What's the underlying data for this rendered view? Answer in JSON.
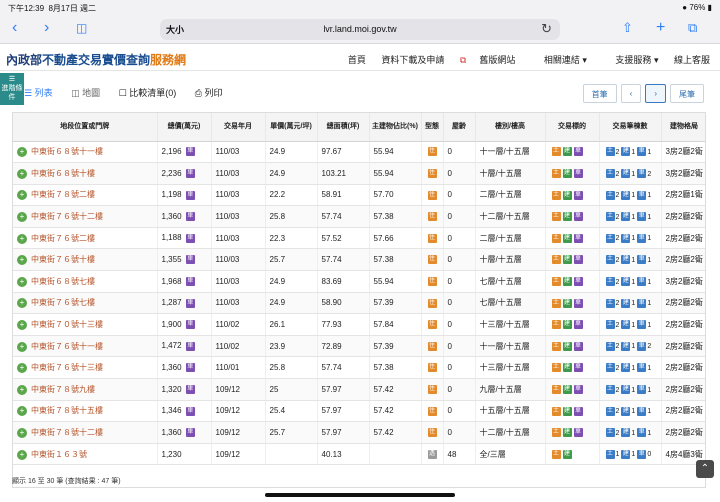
{
  "status": {
    "time": "下午12:39",
    "date": "8月17日 週二",
    "battery": "76%"
  },
  "browser": {
    "aa": "大小",
    "url": "lvr.land.moi.gov.tw"
  },
  "header": {
    "ministry": "內政部",
    "title_main": "不動產交易實價查詢",
    "title_sub": "服務網",
    "nav": [
      "首頁",
      "資料下載及申請",
      "舊版網站",
      "相關連結",
      "支援服務",
      "線上客服"
    ]
  },
  "sidetag": "進階條件",
  "viewbar": {
    "list": "列表",
    "map": "地圖",
    "compare": "比較清單(0)",
    "print": "列印"
  },
  "pager": {
    "first": "首筆",
    "prev": "‹",
    "next": "›",
    "last": "尾筆"
  },
  "columns": [
    "地段位置或門牌",
    "總價(萬元)",
    "交易年月",
    "單價(萬元/坪)",
    "總面積(坪)",
    "主建物佔比(%)",
    "型態",
    "屋齡",
    "樓別/樓高",
    "交易標的",
    "交易筆棟數",
    "建物格局"
  ],
  "rows": [
    {
      "addr": "中東街６８號十一樓",
      "price": "2,196",
      "date": "110/03",
      "unit": "24.9",
      "area": "97.67",
      "ratio": "55.94",
      "type": "住",
      "age": "0",
      "floor": "十一層/十五層",
      "c1": "2",
      "c2": "1",
      "c3": "1",
      "layout": "3房2廳2衛",
      "ptag": true
    },
    {
      "addr": "中東街６８號十樓",
      "price": "2,236",
      "date": "110/03",
      "unit": "24.9",
      "area": "103.21",
      "ratio": "55.94",
      "type": "住",
      "age": "0",
      "floor": "十層/十五層",
      "c1": "2",
      "c2": "1",
      "c3": "2",
      "layout": "3房2廳2衛",
      "ptag": true
    },
    {
      "addr": "中東街７８號二樓",
      "price": "1,198",
      "date": "110/03",
      "unit": "22.2",
      "area": "58.91",
      "ratio": "57.70",
      "type": "住",
      "age": "0",
      "floor": "二層/十五層",
      "c1": "2",
      "c2": "1",
      "c3": "1",
      "layout": "2房2廳1衛",
      "ptag": true
    },
    {
      "addr": "中東街７６號十二樓",
      "price": "1,360",
      "date": "110/03",
      "unit": "25.8",
      "area": "57.74",
      "ratio": "57.38",
      "type": "住",
      "age": "0",
      "floor": "十二層/十五層",
      "c1": "2",
      "c2": "1",
      "c3": "1",
      "layout": "2房2廳2衛",
      "ptag": true
    },
    {
      "addr": "中東街７６號二樓",
      "price": "1,188",
      "date": "110/03",
      "unit": "22.3",
      "area": "57.52",
      "ratio": "57.66",
      "type": "住",
      "age": "0",
      "floor": "二層/十五層",
      "c1": "2",
      "c2": "1",
      "c3": "1",
      "layout": "2房2廳2衛",
      "ptag": true
    },
    {
      "addr": "中東街７６號十樓",
      "price": "1,355",
      "date": "110/03",
      "unit": "25.7",
      "area": "57.74",
      "ratio": "57.38",
      "type": "住",
      "age": "0",
      "floor": "十層/十五層",
      "c1": "2",
      "c2": "1",
      "c3": "1",
      "layout": "2房2廳2衛",
      "ptag": true
    },
    {
      "addr": "中東街６８號七樓",
      "price": "1,968",
      "date": "110/03",
      "unit": "24.9",
      "area": "83.69",
      "ratio": "55.94",
      "type": "住",
      "age": "0",
      "floor": "七層/十五層",
      "c1": "2",
      "c2": "1",
      "c3": "1",
      "layout": "3房2廳2衛",
      "ptag": true
    },
    {
      "addr": "中東街７６號七樓",
      "price": "1,287",
      "date": "110/03",
      "unit": "24.9",
      "area": "58.90",
      "ratio": "57.39",
      "type": "住",
      "age": "0",
      "floor": "七層/十五層",
      "c1": "2",
      "c2": "1",
      "c3": "1",
      "layout": "2房2廳2衛",
      "ptag": true
    },
    {
      "addr": "中東街７０號十三樓",
      "price": "1,900",
      "date": "110/02",
      "unit": "26.1",
      "area": "77.93",
      "ratio": "57.84",
      "type": "住",
      "age": "0",
      "floor": "十三層/十五層",
      "c1": "2",
      "c2": "1",
      "c3": "1",
      "layout": "2房2廳2衛",
      "ptag": true
    },
    {
      "addr": "中東街７６號十一樓",
      "price": "1,472",
      "date": "110/02",
      "unit": "23.9",
      "area": "72.89",
      "ratio": "57.39",
      "type": "住",
      "age": "0",
      "floor": "十一層/十五層",
      "c1": "2",
      "c2": "1",
      "c3": "2",
      "layout": "2房2廳2衛",
      "ptag": true
    },
    {
      "addr": "中東街７６號十三樓",
      "price": "1,360",
      "date": "110/01",
      "unit": "25.8",
      "area": "57.74",
      "ratio": "57.38",
      "type": "住",
      "age": "0",
      "floor": "十三層/十五層",
      "c1": "2",
      "c2": "1",
      "c3": "1",
      "layout": "2房2廳2衛",
      "ptag": true
    },
    {
      "addr": "中東街７８號九樓",
      "price": "1,320",
      "date": "109/12",
      "unit": "25",
      "area": "57.97",
      "ratio": "57.42",
      "type": "住",
      "age": "0",
      "floor": "九層/十五層",
      "c1": "2",
      "c2": "1",
      "c3": "1",
      "layout": "2房2廳2衛",
      "ptag": true
    },
    {
      "addr": "中東街７８號十五樓",
      "price": "1,346",
      "date": "109/12",
      "unit": "25.4",
      "area": "57.97",
      "ratio": "57.42",
      "type": "住",
      "age": "0",
      "floor": "十五層/十五層",
      "c1": "2",
      "c2": "1",
      "c3": "1",
      "layout": "2房2廳2衛",
      "ptag": true
    },
    {
      "addr": "中東街７８號十二樓",
      "price": "1,360",
      "date": "109/12",
      "unit": "25.7",
      "area": "57.97",
      "ratio": "57.42",
      "type": "住",
      "age": "0",
      "floor": "十二層/十五層",
      "c1": "2",
      "c2": "1",
      "c3": "1",
      "layout": "2房2廳2衛",
      "ptag": true
    },
    {
      "addr": "中東街１６３號",
      "price": "1,230",
      "date": "109/12",
      "unit": "",
      "area": "40.13",
      "ratio": "",
      "type": "透",
      "age": "48",
      "floor": "全/三層",
      "c1": "1",
      "c2": "1",
      "c3": "0",
      "layout": "4房4廳3衛",
      "ptag": false
    }
  ],
  "tag_labels": {
    "land": "土",
    "building": "建",
    "park": "車",
    "price_tag": "車"
  },
  "footer": "顯示 16 至 30 筆 (查詢結果 : 47 筆)",
  "colors": {
    "accent": "#2f7df6",
    "address": "#b5542a",
    "brand_blue": "#1a4d8f",
    "brand_orange": "#e07a15"
  }
}
